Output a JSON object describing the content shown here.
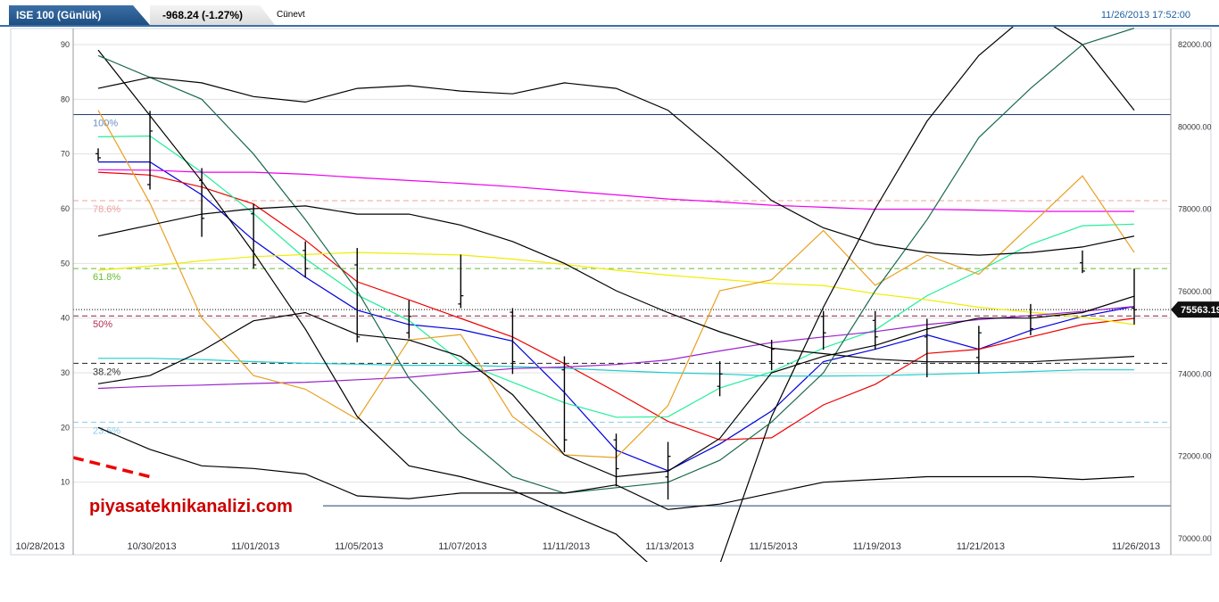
{
  "header": {
    "symbol": "ISE 100 (Günlük)",
    "change": "-968.24 (-1.27%)",
    "user": "Cünevt",
    "timestamp": "11/26/2013 17:52:00"
  },
  "watermark": "piyasateknikanalizi.com",
  "colors": {
    "accent": "#1f5fa0",
    "brand_red": "#cc0000",
    "fib_line": "#1f3f6f"
  },
  "chart_data": {
    "type": "line",
    "x": [
      "10/29",
      "10/30",
      "10/31",
      "11/01",
      "11/04",
      "11/05",
      "11/06",
      "11/07",
      "11/08",
      "11/11",
      "11/12",
      "11/13",
      "11/14",
      "11/15",
      "11/18",
      "11/19",
      "11/20",
      "11/21",
      "11/22",
      "11/25",
      "11/26"
    ],
    "x_tick_labels": [
      "10/28/2013",
      "10/30/2013",
      "11/01/2013",
      "11/05/2013",
      "11/07/2013",
      "11/11/2013",
      "11/13/2013",
      "11/15/2013",
      "11/19/2013",
      "11/21/2013",
      "11/26/2013"
    ],
    "y_left": {
      "ylim": [
        0,
        90
      ],
      "ticks": [
        10,
        20,
        30,
        40,
        50,
        60,
        70,
        80,
        90
      ]
    },
    "y_right": {
      "ylim": [
        70000,
        82000
      ],
      "ticks": [
        "70000.00",
        "72000.00",
        "74000.00",
        "76000.00",
        "78000.00",
        "80000.00",
        "82000.00"
      ]
    },
    "last_price": "75563.19",
    "price_bars": [
      {
        "x": "10/29",
        "high": 79480,
        "low": 79170,
        "open": 79350,
        "close": 79250
      },
      {
        "x": "10/30",
        "high": 80390,
        "low": 78480,
        "open": 78600,
        "close": 79900
      },
      {
        "x": "10/31",
        "high": 79000,
        "low": 77330,
        "open": 78700,
        "close": 77780
      },
      {
        "x": "11/01",
        "high": 78130,
        "low": 76560,
        "open": 77890,
        "close": 76650
      },
      {
        "x": "11/04",
        "high": 77220,
        "low": 76340,
        "open": 77000,
        "close": 76560
      },
      {
        "x": "11/05",
        "high": 77060,
        "low": 74770,
        "open": 76650,
        "close": 74900
      },
      {
        "x": "11/06",
        "high": 75790,
        "low": 74860,
        "open": 75000,
        "close": 75400
      },
      {
        "x": "11/07",
        "high": 76900,
        "low": 75600,
        "open": 75700,
        "close": 75900
      },
      {
        "x": "11/08",
        "high": 75600,
        "low": 74000,
        "open": 75500,
        "close": 74300
      },
      {
        "x": "11/11",
        "high": 74430,
        "low": 72100,
        "open": 74100,
        "close": 72400
      },
      {
        "x": "11/12",
        "high": 72550,
        "low": 71270,
        "open": 72400,
        "close": 71700
      },
      {
        "x": "11/13",
        "high": 72350,
        "low": 70950,
        "open": 71500,
        "close": 72000
      },
      {
        "x": "11/14",
        "high": 74310,
        "low": 73460,
        "open": 73700,
        "close": 74000
      },
      {
        "x": "11/15",
        "high": 74830,
        "low": 74090,
        "open": 74300,
        "close": 74600
      },
      {
        "x": "11/18",
        "high": 75530,
        "low": 74590,
        "open": 75400,
        "close": 75000
      },
      {
        "x": "11/19",
        "high": 75530,
        "low": 74590,
        "open": 75300,
        "close": 74900
      },
      {
        "x": "11/20",
        "high": 75340,
        "low": 73920,
        "open": 74900,
        "close": 75100
      },
      {
        "x": "11/21",
        "high": 75170,
        "low": 74010,
        "open": 74400,
        "close": 75000
      },
      {
        "x": "11/22",
        "high": 75700,
        "low": 74940,
        "open": 75400,
        "close": 75100
      },
      {
        "x": "11/25",
        "high": 77000,
        "low": 76450,
        "open": 76700,
        "close": 76500
      },
      {
        "x": "11/26",
        "high": 76560,
        "low": 75200,
        "open": 75600,
        "close": 75560
      }
    ],
    "fib_levels": [
      {
        "label": "100%",
        "value": 80300,
        "color": "#6a8fc0",
        "style": "solid",
        "line_color": "#1f3f6f"
      },
      {
        "label": "78.6%",
        "value": 78210,
        "color": "#f0a0a0",
        "style": "dashed",
        "line_color": "#f0a0a0"
      },
      {
        "label": "61.8%",
        "value": 76560,
        "color": "#66bb33",
        "style": "dashed",
        "line_color": "#66bb33"
      },
      {
        "label": "50%",
        "value": 75410,
        "color": "#b03050",
        "style": "dashed",
        "line_color": "#8b2040"
      },
      {
        "label": "38.2%",
        "value": 74260,
        "color": "#333333",
        "style": "dashed",
        "line_color": "#222222"
      },
      {
        "label": "23.6%",
        "value": 72830,
        "color": "#88ccee",
        "style": "dashed",
        "line_color": "#88ccee"
      },
      {
        "label": "",
        "value": 70800,
        "color": "#1f3f6f",
        "style": "solid",
        "line_color": "#1f3f6f"
      }
    ],
    "series": [
      {
        "color": "#0000dd",
        "axis": "price",
        "values": [
          79150,
          79150,
          78350,
          77250,
          76350,
          75550,
          75200,
          75080,
          74800,
          73550,
          72150,
          71650,
          72300,
          73100,
          74300,
          74600,
          74950,
          74600,
          75060,
          75400,
          75640
        ]
      },
      {
        "color": "#ee0000",
        "axis": "price",
        "values": [
          78900,
          78830,
          78540,
          78130,
          77250,
          76240,
          75800,
          75350,
          74900,
          74250,
          73560,
          72850,
          72400,
          72450,
          73250,
          73750,
          74500,
          74600,
          74900,
          75200,
          75350
        ]
      },
      {
        "color": "#22ee99",
        "axis": "price",
        "values": [
          79760,
          79780,
          78900,
          77900,
          76800,
          75920,
          75300,
          74300,
          73800,
          73300,
          72950,
          72960,
          73660,
          74050,
          74630,
          75070,
          75900,
          76500,
          77150,
          77600,
          77640
        ]
      },
      {
        "color": "#ee00ee",
        "axis": "price",
        "values": [
          78960,
          78950,
          78900,
          78900,
          78850,
          78770,
          78700,
          78630,
          78550,
          78450,
          78350,
          78250,
          78180,
          78100,
          78050,
          78000,
          78000,
          77980,
          77950,
          77950,
          77950
        ]
      },
      {
        "color": "#eeee00",
        "axis": "price",
        "values": [
          76520,
          76620,
          76750,
          76850,
          76900,
          76950,
          76920,
          76890,
          76790,
          76660,
          76520,
          76400,
          76300,
          76200,
          76150,
          75950,
          75800,
          75620,
          75500,
          75380,
          75200
        ]
      },
      {
        "color": "#22cccc",
        "axis": "price",
        "values": [
          74380,
          74380,
          74350,
          74300,
          74260,
          74240,
          74210,
          74210,
          74180,
          74140,
          74080,
          74030,
          74000,
          73950,
          73950,
          73960,
          73990,
          74020,
          74060,
          74100,
          74100
        ]
      },
      {
        "color": "#9922cc",
        "axis": "price",
        "values": [
          73650,
          73700,
          73730,
          73770,
          73800,
          73860,
          73920,
          74030,
          74130,
          74170,
          74230,
          74340,
          74560,
          74760,
          74900,
          75030,
          75200,
          75320,
          75420,
          75520,
          75640
        ]
      },
      {
        "color": "#e8a020",
        "axis": "oscillator",
        "values": [
          78,
          61,
          40,
          29.5,
          27,
          21.5,
          36,
          37,
          22,
          15,
          14.5,
          24,
          45,
          47,
          56,
          46,
          51.5,
          48,
          57,
          66,
          52
        ]
      },
      {
        "color": "#000000",
        "axis": "oscillator",
        "values": [
          89,
          77,
          65,
          52,
          38,
          22,
          13,
          11,
          8.5,
          4.5,
          0.5,
          -8,
          -5,
          22,
          42,
          60,
          76,
          88,
          96,
          90,
          78
        ]
      },
      {
        "color": "#1a6a4a",
        "axis": "oscillator",
        "values": [
          88,
          84,
          80,
          70,
          58,
          45,
          29,
          19,
          11,
          8,
          9,
          10,
          14,
          21,
          30,
          45,
          58,
          73,
          82,
          90,
          93
        ]
      },
      {
        "color": "#000000",
        "axis": "oscillator",
        "values": [
          82,
          84,
          83,
          80.5,
          79.5,
          82,
          82.5,
          81.5,
          81,
          83,
          82,
          78,
          70,
          61.5,
          56.5,
          53.5,
          52,
          51.5,
          52,
          53,
          55
        ]
      },
      {
        "color": "#000000",
        "axis": "oscillator",
        "values": [
          55,
          57,
          59,
          60,
          60.5,
          59,
          59,
          57,
          54,
          50,
          45,
          41,
          37.5,
          34.5,
          33.5,
          32.5,
          32,
          32,
          32,
          32.5,
          33
        ]
      },
      {
        "color": "#000000",
        "axis": "oscillator",
        "values": [
          28,
          29.5,
          34,
          39.5,
          41,
          37,
          36,
          33,
          26,
          15,
          11,
          12,
          18,
          30,
          33,
          35,
          38,
          40,
          40,
          41,
          44
        ]
      },
      {
        "color": "#000000",
        "axis": "oscillator",
        "values": [
          20,
          16,
          13,
          12.5,
          11.5,
          7.5,
          7,
          8,
          8,
          8,
          9.5,
          5,
          6,
          8,
          10,
          10.5,
          11,
          11,
          11,
          10.5,
          11
        ]
      }
    ],
    "trendline": {
      "color": "#ee0000",
      "style": "dashed",
      "x": [
        "10/28",
        "10/30"
      ],
      "y": [
        14.5,
        11
      ]
    }
  }
}
